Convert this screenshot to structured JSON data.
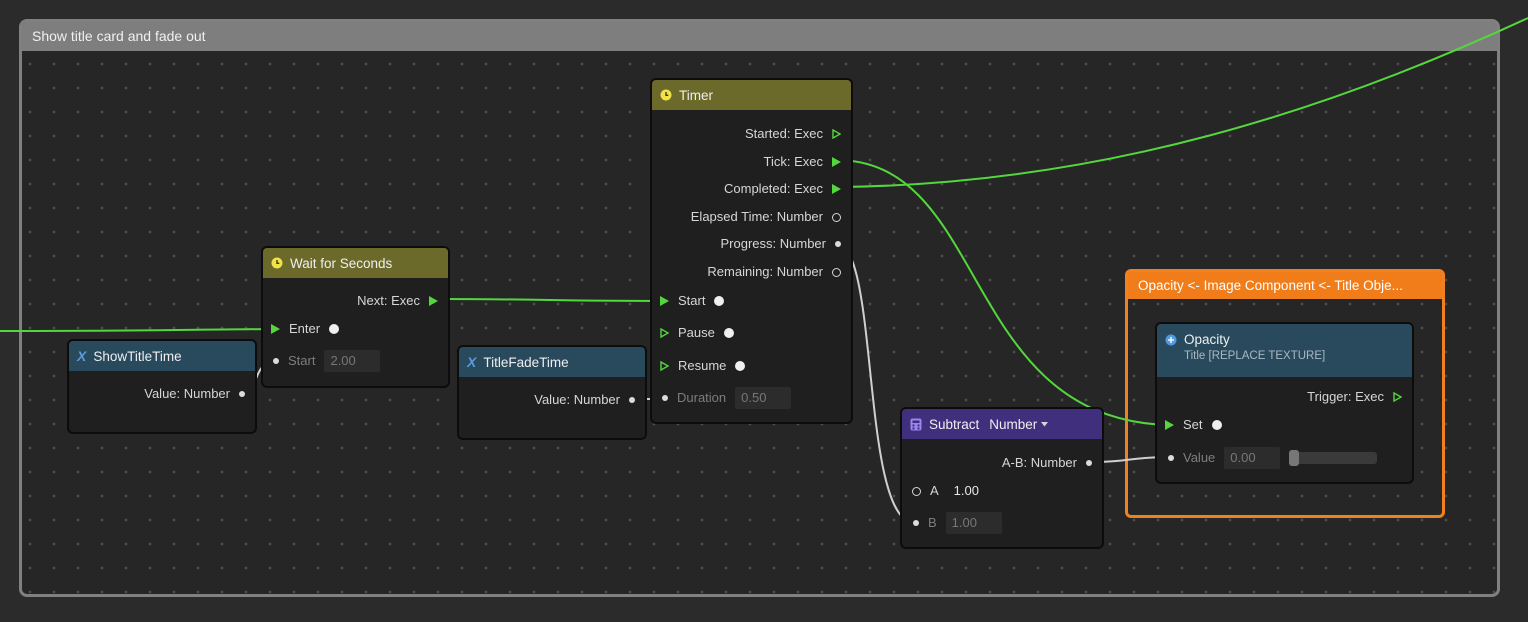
{
  "group": {
    "title": "Show title card and fade out"
  },
  "nodes": {
    "timer": {
      "title": "Timer",
      "outputs": [
        "Started: Exec",
        "Tick: Exec",
        "Completed: Exec",
        "Elapsed Time: Number",
        "Progress: Number",
        "Remaining: Number"
      ],
      "inputs": {
        "start": "Start",
        "pause": "Pause",
        "resume": "Resume",
        "duration": "Duration",
        "duration_value": "0.50"
      }
    },
    "wait": {
      "title": "Wait for Seconds",
      "next": "Next: Exec",
      "enter": "Enter",
      "start": "Start",
      "start_value": "2.00"
    },
    "show_title_time": {
      "title": "ShowTitleTime",
      "value": "Value: Number"
    },
    "title_fade_time": {
      "title": "TitleFadeTime",
      "value": "Value: Number"
    },
    "subtract": {
      "title": "Subtract",
      "type": "Number",
      "output": "A-B: Number",
      "a_label": "A",
      "a_value": "1.00",
      "b_label": "B",
      "b_value": "1.00"
    },
    "opacity": {
      "title": "Opacity",
      "subtitle": "Title [REPLACE TEXTURE]",
      "trigger": "Trigger: Exec",
      "set": "Set",
      "value_label": "Value",
      "value": "0.00"
    }
  },
  "selection_group": {
    "title": "Opacity <- Image Component <- Title Obje..."
  },
  "colors": {
    "exec": "#54d63d",
    "selection": "#f08020",
    "background": "#2b2b2b"
  }
}
